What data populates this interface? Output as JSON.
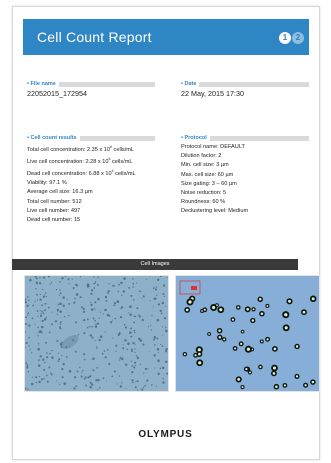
{
  "header": {
    "title": "Cell Count Report",
    "page_current": "1",
    "page_other": "2"
  },
  "file_name": {
    "title": "File name",
    "value": "22052015_172954"
  },
  "date": {
    "title": "Date",
    "value": "22 May, 2015 17:30"
  },
  "results": {
    "title": "Cell count results",
    "lines": [
      {
        "text": "Total cell concentration: 2.35 x 10",
        "exp": "6",
        "unit": " cells/mL"
      },
      {
        "text": "Live cell concentration: 2.28 x 10",
        "exp": "6",
        "unit": " cells/mL"
      },
      {
        "text": "Dead cell concentration: 6.88 x 10",
        "exp": "4",
        "unit": " cells/mL"
      },
      {
        "text": "Viability: 97.1 %"
      },
      {
        "text": "Average cell size: 16.3 µm"
      },
      {
        "text": "Total cell number: 512"
      },
      {
        "text": "Live cell number: 497"
      },
      {
        "text": "Dead cell number: 15"
      }
    ]
  },
  "protocol": {
    "title": "Protocol",
    "lines": [
      "Protocol name: DEFAULT",
      "Dilution factor: 2",
      "Min. cell size: 3 µm",
      "Max. cell size: 60 µm",
      "Size gating: 3 – 60 µm",
      "Noise reduction: 5",
      "Roundness: 60 %",
      "Declustering level: Medium"
    ]
  },
  "cell_images": {
    "title": "Cell Images",
    "colors": {
      "field_left": "#8fb0c9",
      "field_right": "#86aed6",
      "cells": "#4a7a7f",
      "marker": "#e23030"
    }
  },
  "footer": {
    "logo": "OLYMPUS"
  }
}
